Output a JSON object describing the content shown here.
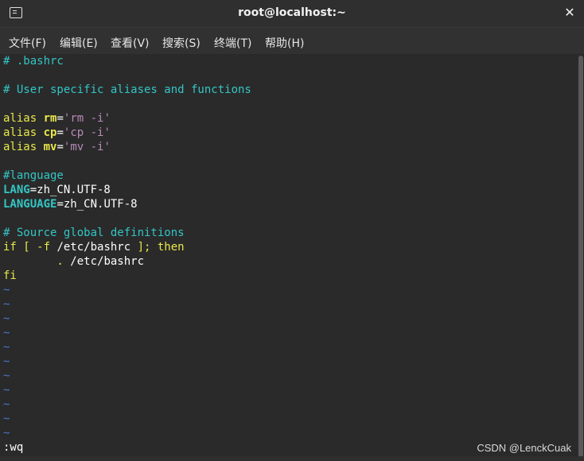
{
  "window": {
    "title": "root@localhost:~"
  },
  "menu": [
    "文件(F)",
    "编辑(E)",
    "查看(V)",
    "搜索(S)",
    "终端(T)",
    "帮助(H)"
  ],
  "lines": {
    "l1": "# .bashrc",
    "l3": "# User specific aliases and functions",
    "l5": {
      "kw": "alias",
      "name": "rm",
      "eq": "=",
      "val": "'rm -i'"
    },
    "l6": {
      "kw": "alias",
      "name": "cp",
      "eq": "=",
      "val": "'cp -i'"
    },
    "l7": {
      "kw": "alias",
      "name": "mv",
      "eq": "=",
      "val": "'mv -i'"
    },
    "l9": "#language",
    "l10": {
      "name": "LANG",
      "rest": "=zh_CN.UTF-8"
    },
    "l11": {
      "name": "LANGUAGE",
      "rest": "=zh_CN.UTF-8"
    },
    "l13": "# Source global definitions",
    "l14": {
      "kw1": "if",
      "mid1": " [ ",
      "flag": "-f",
      "path": " /etc/bashrc ",
      "mid2": "];",
      "kw2": " then"
    },
    "l15": {
      "dot": "        . ",
      "path": "/etc/bashrc"
    },
    "l16": "fi",
    "tilde": "~",
    "command": ":wq"
  },
  "watermark": "CSDN @LenckCuak",
  "colors": {
    "comment": "#34c5c6",
    "keyword": "#e8e84c",
    "string": "#b88ab8",
    "tilde": "#4a78c8",
    "background": "#2a2a2a"
  }
}
